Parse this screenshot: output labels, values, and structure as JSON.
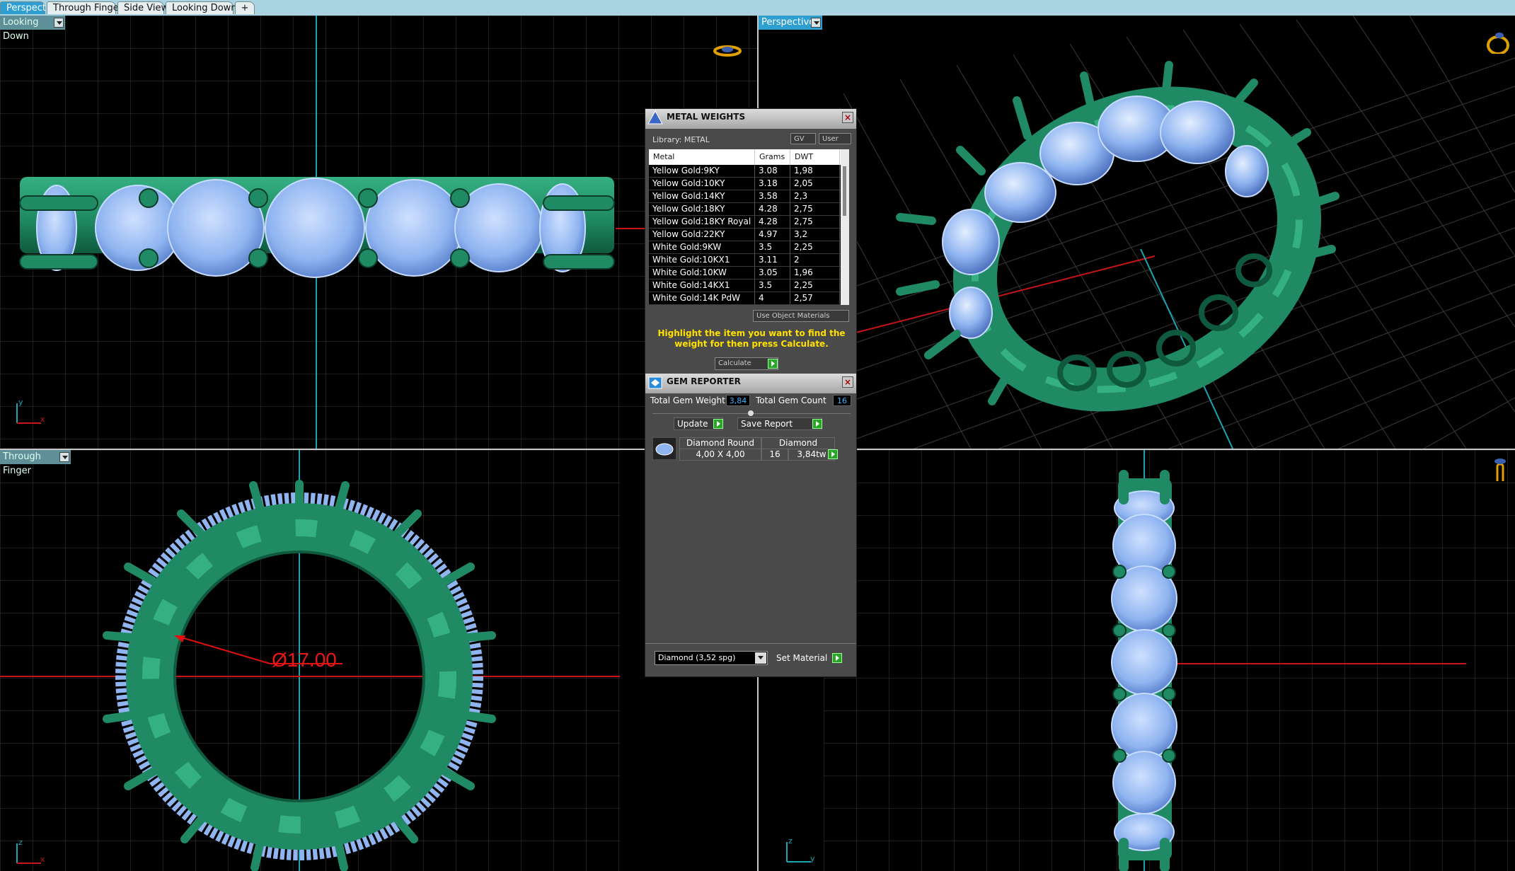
{
  "tabs": [
    "Perspective",
    "Through Finger",
    "Side View",
    "Looking Down",
    "+"
  ],
  "viewports": {
    "top_left": {
      "label": "Looking Down"
    },
    "top_right": {
      "label": "Perspective"
    },
    "bottom_left": {
      "label": "Through Finger",
      "dimension": "Ø17.00"
    },
    "bottom_right": {
      "label": ""
    }
  },
  "axis_letters": {
    "tl_up": "y",
    "tl_right": "x",
    "bl_up": "z",
    "bl_right": "x",
    "br_up": "z",
    "br_right": "y"
  },
  "metal_weights": {
    "title": "METAL WEIGHTS",
    "library": "Library: METAL",
    "toggle_gv": "GV",
    "toggle_user": "User",
    "columns": [
      "Metal",
      "Grams",
      "DWT"
    ],
    "rows": [
      [
        "Yellow Gold:9KY",
        "3.08",
        "1,98"
      ],
      [
        "Yellow Gold:10KY",
        "3.18",
        "2,05"
      ],
      [
        "Yellow Gold:14KY",
        "3.58",
        "2,3"
      ],
      [
        "Yellow Gold:18KY",
        "4.28",
        "2,75"
      ],
      [
        "Yellow Gold:18KY Royal",
        "4.28",
        "2,75"
      ],
      [
        "Yellow Gold:22KY",
        "4.97",
        "3,2"
      ],
      [
        "White Gold:9KW",
        "3.5",
        "2,25"
      ],
      [
        "White Gold:10KX1",
        "3.11",
        "2"
      ],
      [
        "White Gold:10KW",
        "3.05",
        "1,96"
      ],
      [
        "White Gold:14KX1",
        "3.5",
        "2,25"
      ],
      [
        "White Gold:14K PdW",
        "4",
        "2,57"
      ]
    ],
    "use_object_materials": "Use Object Materials",
    "hint": "Highlight the item you want to find the weight for then press Calculate.",
    "calculate": "Calculate"
  },
  "gem_reporter": {
    "title": "GEM REPORTER",
    "total_weight_label": "Total Gem Weight",
    "total_weight_value": "3,84",
    "total_count_label": "Total Gem Count",
    "total_count_value": "16",
    "update": "Update",
    "save_report": "Save Report",
    "gem": {
      "shape": "Diamond Round",
      "size": "4,00 X 4,00",
      "material": "Diamond",
      "count": "16",
      "weight": "3,84tw"
    },
    "material_select": "Diamond     (3,52 spg)",
    "set_material": "Set Material"
  },
  "colors": {
    "metal_green": "#1f8a63",
    "gem_blue": "#8fb4f0",
    "grid": "#3a3a3a",
    "axis_red": "#c81414",
    "axis_cyan": "#1aa5b5",
    "highlight_yellow": "#ffe000"
  }
}
